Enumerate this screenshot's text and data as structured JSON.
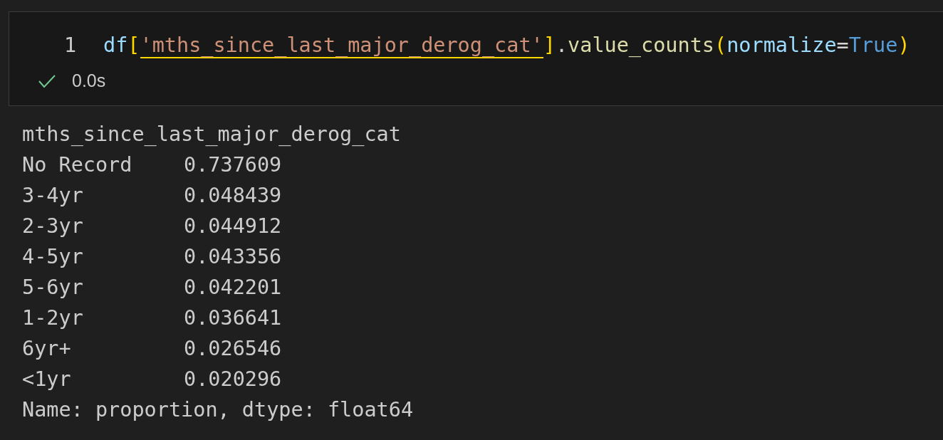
{
  "cell": {
    "line_number": "1",
    "code": [
      {
        "text": "df",
        "kind": "variable"
      },
      {
        "text": "[",
        "kind": "bracket"
      },
      {
        "text": "'mths_since_last_major_derog_cat'",
        "kind": "string",
        "underlined": true
      },
      {
        "text": "]",
        "kind": "bracket"
      },
      {
        "text": ".",
        "kind": "punct"
      },
      {
        "text": "value_counts",
        "kind": "function"
      },
      {
        "text": "(",
        "kind": "bracket"
      },
      {
        "text": "normalize",
        "kind": "parameter"
      },
      {
        "text": "=",
        "kind": "punct"
      },
      {
        "text": "True",
        "kind": "keyword"
      },
      {
        "text": ")",
        "kind": "bracket"
      }
    ],
    "status": {
      "succeeded": true,
      "duration": "0.0s"
    }
  },
  "output": {
    "header": "mths_since_last_major_derog_cat",
    "rows": [
      {
        "label": "No Record",
        "value": "0.737609"
      },
      {
        "label": "3-4yr",
        "value": "0.048439"
      },
      {
        "label": "2-3yr",
        "value": "0.044912"
      },
      {
        "label": "4-5yr",
        "value": "0.043356"
      },
      {
        "label": "5-6yr",
        "value": "0.042201"
      },
      {
        "label": "1-2yr",
        "value": "0.036641"
      },
      {
        "label": "6yr+",
        "value": "0.026546"
      },
      {
        "label": "<1yr",
        "value": "0.020296"
      }
    ],
    "footer": "Name: proportion, dtype: float64"
  }
}
